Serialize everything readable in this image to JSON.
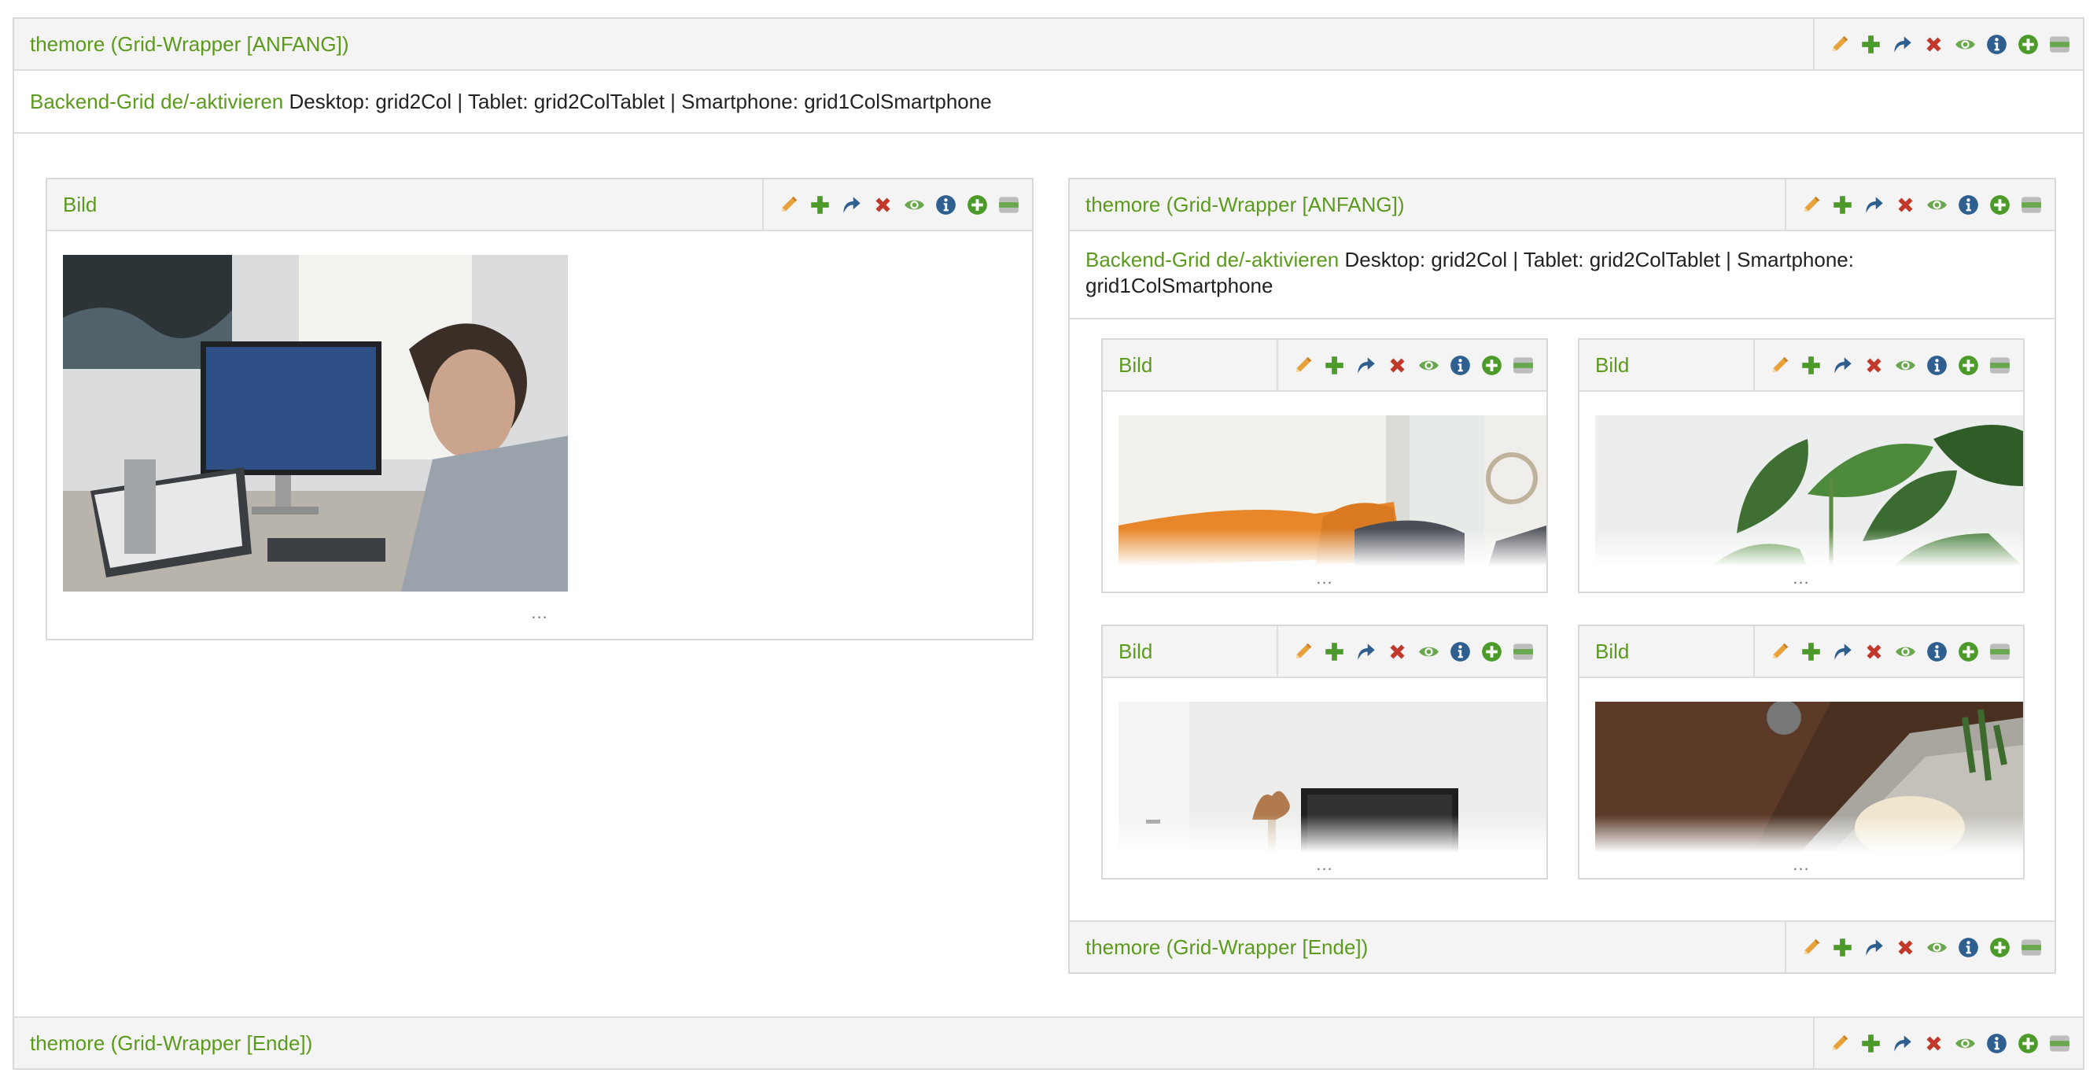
{
  "outer": {
    "title_start": "themore (Grid-Wrapper [ANFANG])",
    "title_end": "themore (Grid-Wrapper [Ende])",
    "toggle_link": "Backend-Grid de/-aktivieren",
    "grid_info": "Desktop: grid2Col | Tablet: grid2ColTablet | Smartphone: grid1ColSmartphone"
  },
  "left_block": {
    "title": "Bild",
    "image_icon": "photo-man-at-computer",
    "more": "..."
  },
  "inner": {
    "title_start": "themore (Grid-Wrapper [ANFANG])",
    "title_end": "themore (Grid-Wrapper [Ende])",
    "toggle_link": "Backend-Grid de/-aktivieren",
    "grid_info": "Desktop: grid2Col | Tablet: grid2ColTablet | Smartphone: grid1ColSmartphone"
  },
  "tiles": [
    {
      "title": "Bild",
      "image_icon": "photo-orange-pillow",
      "more": "..."
    },
    {
      "title": "Bild",
      "image_icon": "photo-green-plant",
      "more": "..."
    },
    {
      "title": "Bild",
      "image_icon": "photo-white-room",
      "more": "..."
    },
    {
      "title": "Bild",
      "image_icon": "photo-wood-table",
      "more": "..."
    }
  ],
  "toolbar_icons": [
    "edit-pencil-icon",
    "add-plus-icon",
    "move-arrow-icon",
    "delete-x-icon",
    "visibility-eye-icon",
    "info-icon",
    "add-circle-icon",
    "collapse-bar-icon"
  ],
  "colors": {
    "title_green": "#5b9a1c",
    "pencil_orange": "#e8a23a",
    "plus_green": "#4c9a2a",
    "move_blue": "#2f5f8f",
    "delete_red": "#c0392b",
    "eye_green": "#6aa84f",
    "info_blue": "#2f5f8f",
    "collapse_gray": "#8a8a8a"
  }
}
